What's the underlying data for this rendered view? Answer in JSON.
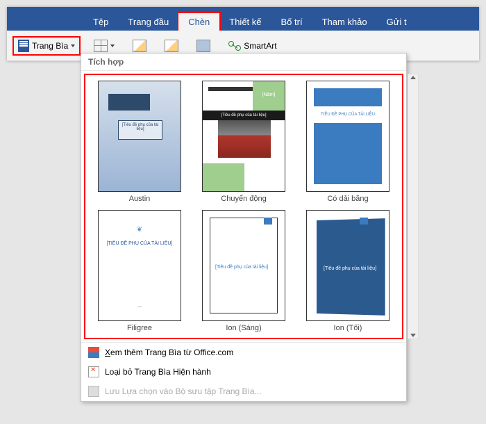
{
  "tabs": {
    "file": "Tệp",
    "home": "Trang đầu",
    "insert": "Chèn",
    "design": "Thiết kế",
    "layout": "Bố trí",
    "references": "Tham khảo",
    "mailings": "Gửi t"
  },
  "ribbon": {
    "coverPage": "Trang Bìa",
    "smartArt": "SmartArt"
  },
  "dropdown": {
    "section": "Tích hợp",
    "items": [
      {
        "name": "Austin",
        "sub": "[Tiêu đề phụ của tài liệu]"
      },
      {
        "name": "Chuyển động",
        "year": "[Năm]",
        "sub": "[Tiêu đề phụ của tài liệu]"
      },
      {
        "name": "Có dải băng",
        "sub": "TIÊU ĐỀ PHỤ CỦA TÀI LIỆU"
      },
      {
        "name": "Filigree",
        "sub": "[TIÊU ĐỀ PHỤ CỦA TÀI LIỆU]"
      },
      {
        "name": "Ion (Sáng)",
        "sub": "[Tiêu đề phụ của tài liệu]"
      },
      {
        "name": "Ion (Tối)",
        "sub": "[Tiêu đề phụ của tài liệu]"
      }
    ],
    "more": "Xem thêm Trang Bìa từ Office.com",
    "remove": "Loại bỏ Trang Bìa Hiện hành",
    "save": "Lưu Lựa chọn vào Bộ sưu tập Trang Bìa..."
  }
}
